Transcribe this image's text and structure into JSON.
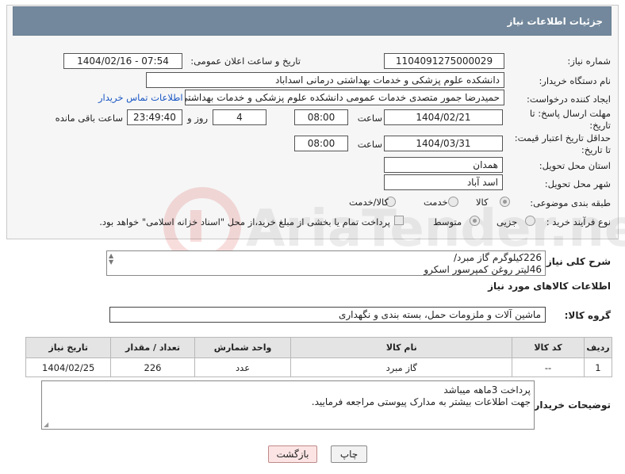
{
  "header": {
    "title": "جزئیات اطلاعات نیاز"
  },
  "need_number": {
    "label": "شماره نیاز:",
    "value": "1104091275000029"
  },
  "announce": {
    "label": "تاریخ و ساعت اعلان عمومی:",
    "value": "1404/02/16 - 07:54"
  },
  "buyer": {
    "label": "نام دستگاه خریدار:",
    "value": "دانشکده علوم پزشکی و خدمات بهداشتی درمانی اسداباد"
  },
  "creator": {
    "label": "ایجاد کننده درخواست:",
    "value": "حمیدرضا جمور متصدی خدمات عمومی  دانشکده علوم پزشکی و خدمات بهداشتی",
    "contact_link": "اطلاعات تماس خریدار"
  },
  "reply_deadline": {
    "label_line1": "مهلت ارسال پاسخ: تا",
    "label_line2": "تاریخ:",
    "date": "1404/02/21",
    "time_label": "ساعت",
    "time": "08:00",
    "days": "4",
    "days_label": "روز و",
    "remaining": "23:49:40",
    "remaining_label": "ساعت باقی مانده"
  },
  "price_validity": {
    "label_line1": "حداقل تاریخ اعتبار قیمت:",
    "label_line2": "تا تاریخ:",
    "date": "1404/03/31",
    "time_label": "ساعت",
    "time": "08:00"
  },
  "province": {
    "label": "استان محل تحویل:",
    "value": "همدان"
  },
  "city": {
    "label": "شهر محل تحویل:",
    "value": "اسد آباد"
  },
  "category": {
    "label": "طبقه بندی موضوعی:",
    "options": [
      "کالا",
      "خدمت",
      "کالا/خدمت"
    ],
    "selected": "کالا"
  },
  "purchase_type": {
    "label": "نوع فرآیند خرید :",
    "options": [
      "جزیی",
      "متوسط"
    ],
    "selected": "متوسط",
    "note": "پرداخت تمام یا بخشی از مبلغ خرید،از محل \"اسناد خزانه اسلامی\" خواهد بود."
  },
  "description": {
    "label": "شرح کلی نیاز:",
    "line1": "226کیلوگرم گاز مبرد/",
    "line2": "46لیتر روغن کمپرسور اسکرو"
  },
  "goods_section": {
    "title": "اطلاعات کالاهای مورد نیاز"
  },
  "goods_group": {
    "label": "گروه کالا:",
    "value": "ماشین آلات و ملزومات حمل، بسته بندی و نگهداری"
  },
  "goods_table": {
    "headers": [
      "ردیف",
      "کد کالا",
      "نام کالا",
      "واحد شمارش",
      "تعداد / مقدار",
      "تاریخ نیاز"
    ],
    "rows": [
      {
        "index": "1",
        "code": "--",
        "name": "گاز مبرد",
        "unit": "عدد",
        "qty": "226",
        "date": "1404/02/25"
      }
    ]
  },
  "buyer_notes": {
    "label": "توضیحات خریدار:",
    "line1": "پرداخت 3ماهه میباشد",
    "line2": "جهت اطلاعات بیشتر به مدارک پیوستی مراجعه فرمایید."
  },
  "buttons": {
    "print": "چاپ",
    "back": "بازگشت"
  },
  "watermark": {
    "text": "AriaTender.neT"
  }
}
